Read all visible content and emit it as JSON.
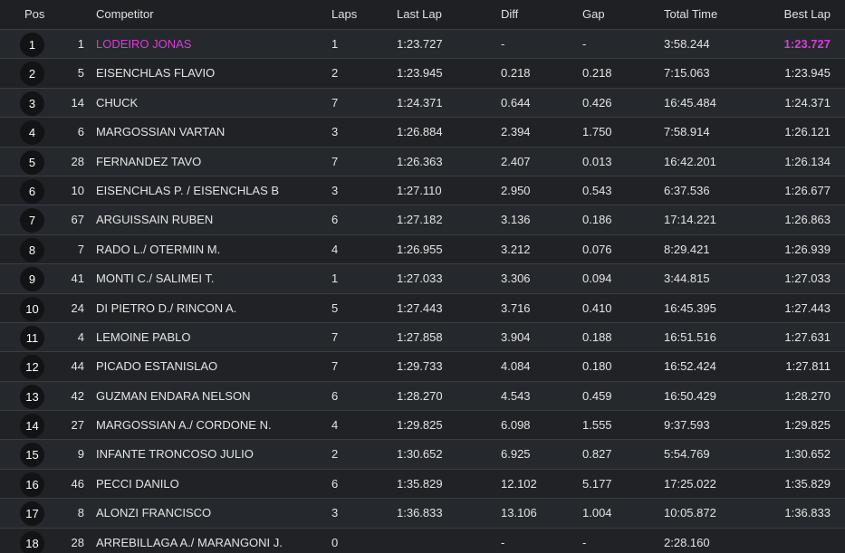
{
  "header": {
    "pos": "Pos",
    "competitor": "Competitor",
    "laps": "Laps",
    "last_lap": "Last Lap",
    "diff": "Diff",
    "gap": "Gap",
    "total_time": "Total Time",
    "best_lap": "Best Lap"
  },
  "colors": {
    "leader_highlight": "#d63fd6",
    "background": "#1e2023",
    "badge": "#121315"
  },
  "rows": [
    {
      "pos": "1",
      "num": "1",
      "name": "LODEIRO JONAS",
      "laps": "1",
      "last": "1:23.727",
      "diff": "-",
      "gap": "-",
      "total": "3:58.244",
      "best": "1:23.727"
    },
    {
      "pos": "2",
      "num": "5",
      "name": "EISENCHLAS FLAVIO",
      "laps": "2",
      "last": "1:23.945",
      "diff": "0.218",
      "gap": "0.218",
      "total": "7:15.063",
      "best": "1:23.945"
    },
    {
      "pos": "3",
      "num": "14",
      "name": "CHUCK",
      "laps": "7",
      "last": "1:24.371",
      "diff": "0.644",
      "gap": "0.426",
      "total": "16:45.484",
      "best": "1:24.371"
    },
    {
      "pos": "4",
      "num": "6",
      "name": "MARGOSSIAN VARTAN",
      "laps": "3",
      "last": "1:26.884",
      "diff": "2.394",
      "gap": "1.750",
      "total": "7:58.914",
      "best": "1:26.121"
    },
    {
      "pos": "5",
      "num": "28",
      "name": "FERNANDEZ TAVO",
      "laps": "7",
      "last": "1:26.363",
      "diff": "2.407",
      "gap": "0.013",
      "total": "16:42.201",
      "best": "1:26.134"
    },
    {
      "pos": "6",
      "num": "10",
      "name": "EISENCHLAS P. / EISENCHLAS B",
      "laps": "3",
      "last": "1:27.110",
      "diff": "2.950",
      "gap": "0.543",
      "total": "6:37.536",
      "best": "1:26.677"
    },
    {
      "pos": "7",
      "num": "67",
      "name": "ARGUISSAIN RUBEN",
      "laps": "6",
      "last": "1:27.182",
      "diff": "3.136",
      "gap": "0.186",
      "total": "17:14.221",
      "best": "1:26.863"
    },
    {
      "pos": "8",
      "num": "7",
      "name": "RADO L./ OTERMIN M.",
      "laps": "4",
      "last": "1:26.955",
      "diff": "3.212",
      "gap": "0.076",
      "total": "8:29.421",
      "best": "1:26.939"
    },
    {
      "pos": "9",
      "num": "41",
      "name": "MONTI C./ SALIMEI T.",
      "laps": "1",
      "last": "1:27.033",
      "diff": "3.306",
      "gap": "0.094",
      "total": "3:44.815",
      "best": "1:27.033"
    },
    {
      "pos": "10",
      "num": "24",
      "name": "DI PIETRO D./ RINCON A.",
      "laps": "5",
      "last": "1:27.443",
      "diff": "3.716",
      "gap": "0.410",
      "total": "16:45.395",
      "best": "1:27.443"
    },
    {
      "pos": "11",
      "num": "4",
      "name": "LEMOINE PABLO",
      "laps": "7",
      "last": "1:27.858",
      "diff": "3.904",
      "gap": "0.188",
      "total": "16:51.516",
      "best": "1:27.631"
    },
    {
      "pos": "12",
      "num": "44",
      "name": "PICADO ESTANISLAO",
      "laps": "7",
      "last": "1:29.733",
      "diff": "4.084",
      "gap": "0.180",
      "total": "16:52.424",
      "best": "1:27.811"
    },
    {
      "pos": "13",
      "num": "42",
      "name": "GUZMAN ENDARA NELSON",
      "laps": "6",
      "last": "1:28.270",
      "diff": "4.543",
      "gap": "0.459",
      "total": "16:50.429",
      "best": "1:28.270"
    },
    {
      "pos": "14",
      "num": "27",
      "name": "MARGOSSIAN A./ CORDONE N.",
      "laps": "4",
      "last": "1:29.825",
      "diff": "6.098",
      "gap": "1.555",
      "total": "9:37.593",
      "best": "1:29.825"
    },
    {
      "pos": "15",
      "num": "9",
      "name": "INFANTE TRONCOSO JULIO",
      "laps": "2",
      "last": "1:30.652",
      "diff": "6.925",
      "gap": "0.827",
      "total": "5:54.769",
      "best": "1:30.652"
    },
    {
      "pos": "16",
      "num": "46",
      "name": "PECCI DANILO",
      "laps": "6",
      "last": "1:35.829",
      "diff": "12.102",
      "gap": "5.177",
      "total": "17:25.022",
      "best": "1:35.829"
    },
    {
      "pos": "17",
      "num": "8",
      "name": "ALONZI FRANCISCO",
      "laps": "3",
      "last": "1:36.833",
      "diff": "13.106",
      "gap": "1.004",
      "total": "10:05.872",
      "best": "1:36.833"
    },
    {
      "pos": "18",
      "num": "28",
      "name": "ARREBILLAGA A./ MARANGONI J.",
      "laps": "0",
      "last": "",
      "diff": "-",
      "gap": "-",
      "total": "2:28.160",
      "best": ""
    }
  ]
}
